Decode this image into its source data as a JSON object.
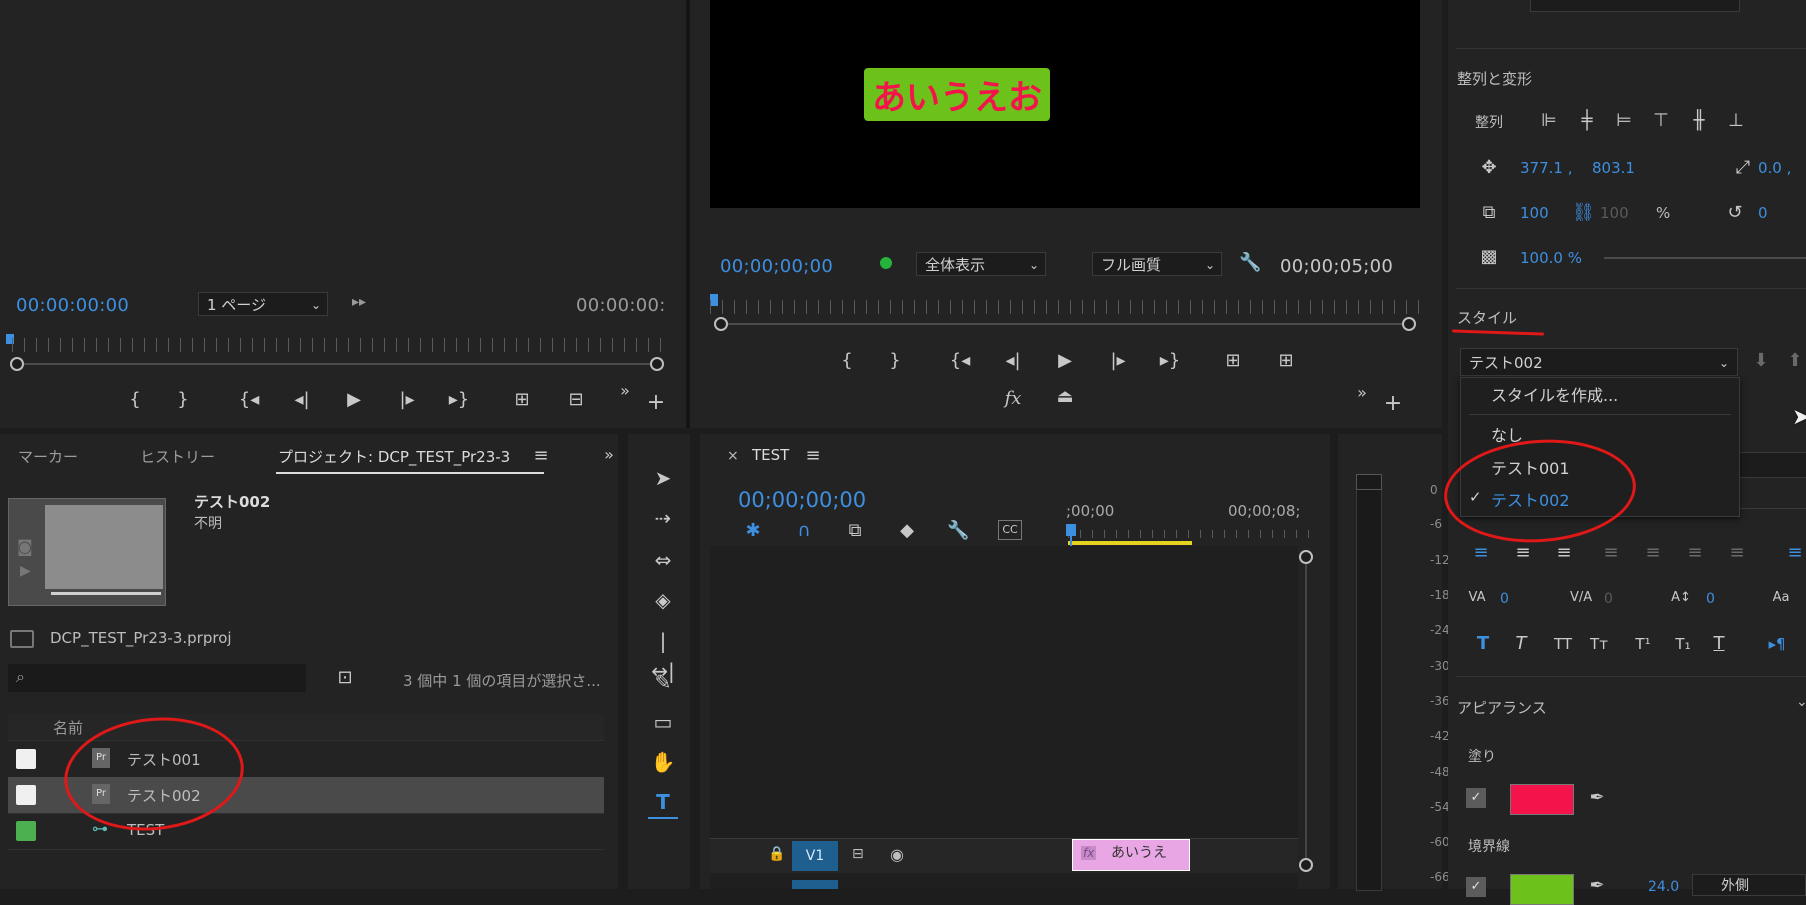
{
  "source_monitor": {
    "timecode": "00:00:00:00",
    "page_select": "1 ページ",
    "duration": "00:00:00:"
  },
  "program_monitor": {
    "preview_text": "あいうえお",
    "timecode": "00;00;00;00",
    "zoom_select": "全体表示",
    "quality_select": "フル画質",
    "duration": "00;00;05;00"
  },
  "project_panel": {
    "tabs": [
      "マーカー",
      "ヒストリー",
      "プロジェクト: DCP_TEST_Pr23-3"
    ],
    "selected_name": "テスト002",
    "selected_info": "不明",
    "project_file": "DCP_TEST_Pr23-3.prproj",
    "selection_status": "3 個中 1 個の項目が選択さ...",
    "column_name": "名前",
    "items": [
      {
        "name": "テスト001",
        "icon": "pr-graphic-icon",
        "color": "#f0f0f0"
      },
      {
        "name": "テスト002",
        "icon": "pr-graphic-icon",
        "color": "#f0f0f0"
      },
      {
        "name": "TEST",
        "icon": "sequence-icon",
        "color": "#4caf50"
      }
    ]
  },
  "timeline": {
    "tab": "TEST",
    "timecode": "00;00;00;00",
    "ruler_start": ";00;00",
    "ruler_mark": "00;00;08;",
    "track": "V1",
    "clip_label": "あいうえ"
  },
  "audio_meter": {
    "labels": [
      "0",
      "-6",
      "-12",
      "-18",
      "-24",
      "-30",
      "-36",
      "-42",
      "-48",
      "-54",
      "-60",
      "-66"
    ]
  },
  "essential_graphics": {
    "align_section": "整列と変形",
    "align_label": "整列",
    "position_x": "377.1 ,",
    "position_y": "803.1",
    "anchor_x": "0.0 ,",
    "scale": "100",
    "scale_locked": "100",
    "scale_unit": "%",
    "rotation": "0",
    "opacity": "100.0 %",
    "style_section": "スタイル",
    "style_select": "テスト002",
    "style_menu": {
      "create": "スタイルを作成...",
      "options": [
        "なし",
        "テスト001",
        "テスト002"
      ],
      "checked": "テスト002"
    },
    "tracking": "0",
    "kerning": "0",
    "leading": "0",
    "appearance_section": "アピアランス",
    "fill_label": "塗り",
    "fill_color": "#f5134b",
    "stroke_label": "境界線",
    "stroke_color": "#6cc21b",
    "stroke_width": "24.0",
    "stroke_type": "外側"
  }
}
